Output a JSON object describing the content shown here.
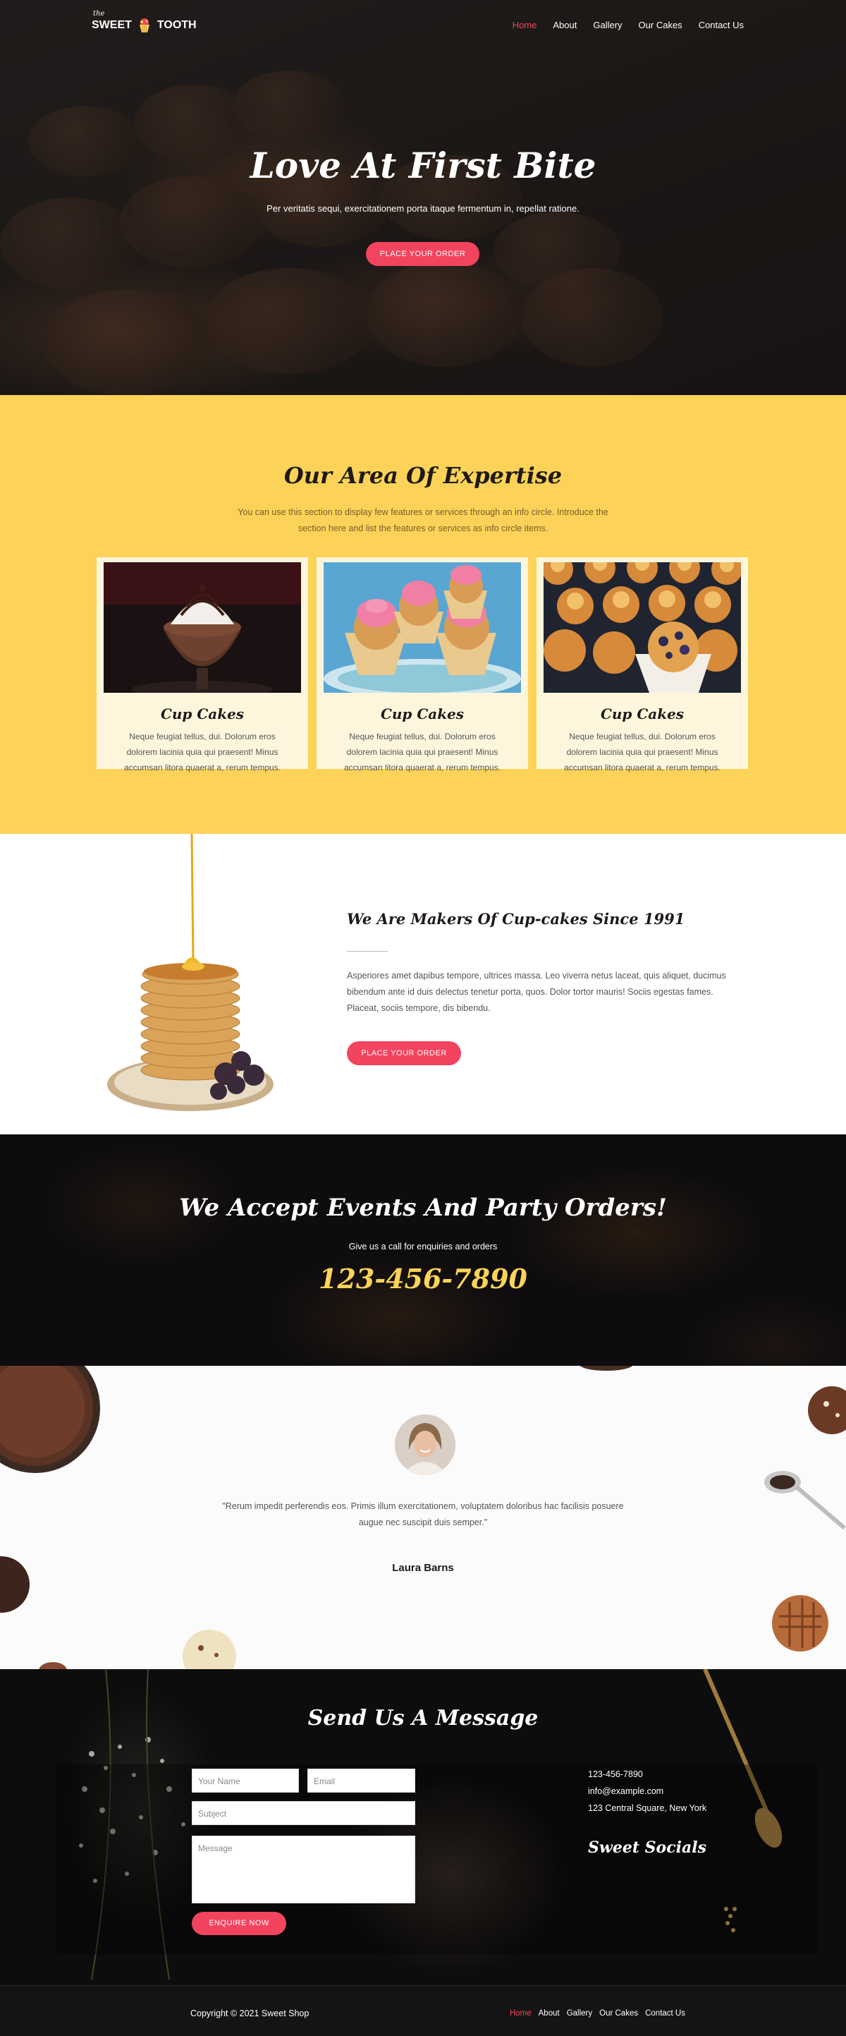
{
  "brand": {
    "prefix": "the",
    "left": "SWEET",
    "right": "TOOTH"
  },
  "nav": {
    "items": [
      "Home",
      "About",
      "Gallery",
      "Our Cakes",
      "Contact Us"
    ],
    "active": "Home"
  },
  "hero": {
    "title": "Love At First Bite",
    "subtitle": "Per veritatis sequi, exercitationem porta itaque fermentum in, repellat ratione.",
    "cta": "PLACE YOUR ORDER"
  },
  "expertise": {
    "title": "Our Area Of Expertise",
    "intro": "You can use this section to display few features or services through an info circle. Introduce the section here and list the features or services as info circle items.",
    "cards": [
      {
        "title": "Cup Cakes",
        "text": "Neque feugiat tellus, dui. Dolorum eros dolorem lacinia quia qui praesent! Minus accumsan litora quaerat a, rerum tempus."
      },
      {
        "title": "Cup Cakes",
        "text": "Neque feugiat tellus, dui. Dolorum eros dolorem lacinia quia qui praesent! Minus accumsan litora quaerat a, rerum tempus."
      },
      {
        "title": "Cup Cakes",
        "text": "Neque feugiat tellus, dui. Dolorum eros dolorem lacinia quia qui praesent! Minus accumsan litora quaerat a, rerum tempus."
      }
    ]
  },
  "makers": {
    "title": "We Are Makers Of Cup-cakes Since 1991",
    "text": "Asperiores amet dapibus tempore, ultrices massa. Leo viverra netus laceat, quis aliquet, ducimus bibendum ante id duis delectus tenetur porta, quos. Dolor tortor mauris! Sociis egestas fames. Placeat, sociis tempore, dis bibendu.",
    "cta": "PLACE YOUR ORDER"
  },
  "events": {
    "title": "We Accept Events And Party Orders!",
    "subtitle": "Give us a call for enquiries and orders",
    "phone": "123-456-7890"
  },
  "testimonial": {
    "quote": "\"Rerum impedit perferendis eos. Primis illum exercitationem, voluptatem doloribus hac facilisis posuere augue nec suscipit duis semper.\"",
    "name": "Laura Barns"
  },
  "contact": {
    "title": "Send Us A Message",
    "name_placeholder": "Your Name",
    "email_placeholder": "Email",
    "subject_placeholder": "Subject",
    "message_placeholder": "Message",
    "submit": "ENQUIRE NOW",
    "phone": "123-456-7890",
    "email": "info@example.com",
    "address": "123 Central Square, New York",
    "socials_title": "Sweet Socials"
  },
  "footer": {
    "copyright": "Copyright © 2021 Sweet Shop",
    "links": [
      "Home",
      "About",
      "Gallery",
      "Our Cakes",
      "Contact Us"
    ]
  },
  "colors": {
    "accent": "#f2445e",
    "yellow": "#fcd358",
    "dark": "#1f1a18"
  }
}
